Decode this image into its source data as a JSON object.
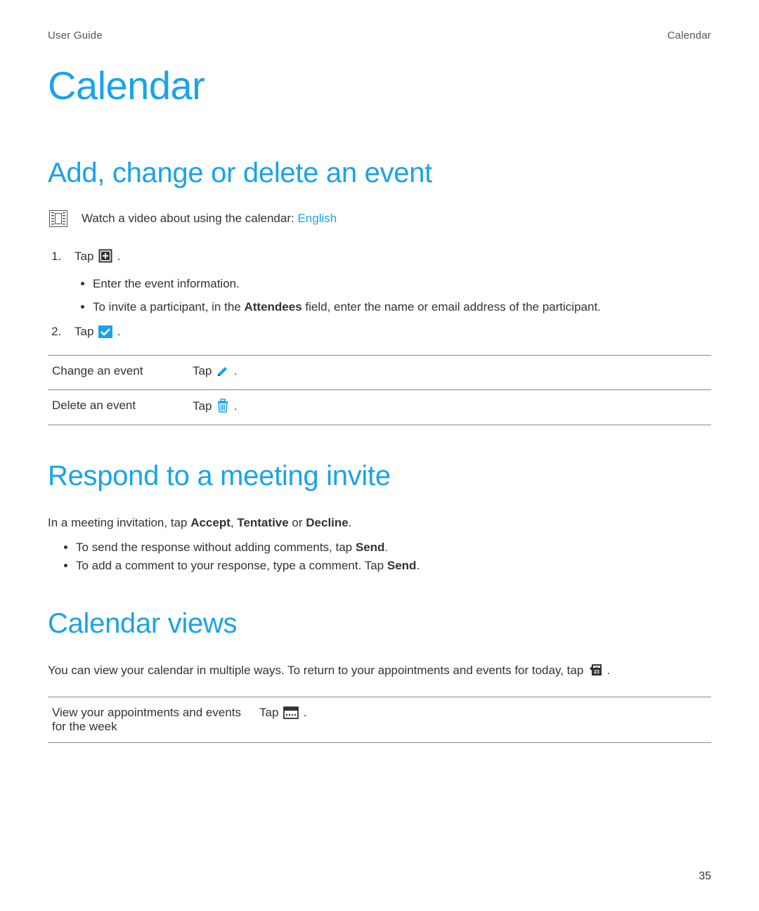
{
  "header": {
    "left": "User Guide",
    "right": "Calendar"
  },
  "page_title": "Calendar",
  "section1": {
    "title": "Add, change or delete an event",
    "video_pre": "Watch a video about using the calendar: ",
    "video_link": "English",
    "step1_pre": "Tap ",
    "step1_post": " .",
    "sub1": "Enter the event information.",
    "sub2_pre": "To invite a participant, in the ",
    "sub2_bold": "Attendees",
    "sub2_post": " field, enter the name or email address of the participant.",
    "step2_pre": "Tap ",
    "step2_post": " .",
    "row1_label": "Change an event",
    "row1_pre": "Tap ",
    "row1_post": " .",
    "row2_label": "Delete an event",
    "row2_pre": "Tap ",
    "row2_post": " ."
  },
  "section2": {
    "title": "Respond to a meeting invite",
    "intro_pre": "In a meeting invitation, tap ",
    "intro_b1": "Accept",
    "intro_sep1": ", ",
    "intro_b2": "Tentative",
    "intro_sep2": " or ",
    "intro_b3": "Decline",
    "intro_post": ".",
    "b1_pre": "To send the response without adding comments, tap ",
    "b1_bold": "Send",
    "b1_post": ".",
    "b2_pre": "To add a comment to your response, type a comment. Tap ",
    "b2_bold": "Send",
    "b2_post": "."
  },
  "section3": {
    "title": "Calendar views",
    "intro_pre": "You can view your calendar in multiple ways. To return to your appointments and events for today, tap ",
    "intro_post": " .",
    "row1_label": "View your appointments and events for the week",
    "row1_pre": "Tap ",
    "row1_post": " ."
  },
  "footer": {
    "page_number": "35"
  }
}
